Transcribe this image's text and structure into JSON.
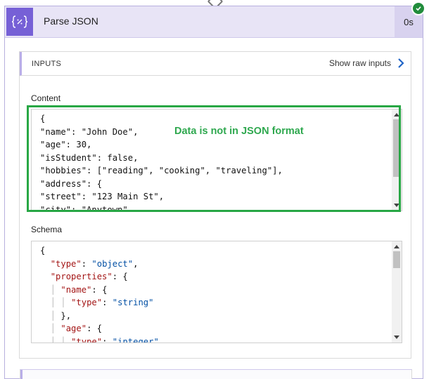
{
  "action": {
    "title": "Parse JSON",
    "icon": "curly-braces-icon",
    "duration": "0s",
    "status": "succeeded",
    "status_color": "#218c3c",
    "accent_color": "#7660d6"
  },
  "inputs": {
    "section_label": "INPUTS",
    "show_raw_label": "Show raw inputs"
  },
  "content": {
    "label": "Content",
    "lines": [
      "{",
      "\"name\": \"John Doe\",",
      "\"age\": 30,",
      "\"isStudent\": false,",
      "\"hobbies\": [\"reading\", \"cooking\", \"traveling\"],",
      "\"address\": {",
      "\"street\": \"123 Main St\",",
      "\"city\": \"Anytown\","
    ]
  },
  "annotation": {
    "text": "Data is not in JSON format",
    "color": "#28a745"
  },
  "schema": {
    "label": "Schema",
    "lines": [
      "{",
      "  \"type\": \"object\",",
      "  \"properties\": {",
      "    \"name\": {",
      "      \"type\": \"string\"",
      "    },",
      "    \"age\": {",
      "      \"type\": \"integer\""
    ]
  }
}
